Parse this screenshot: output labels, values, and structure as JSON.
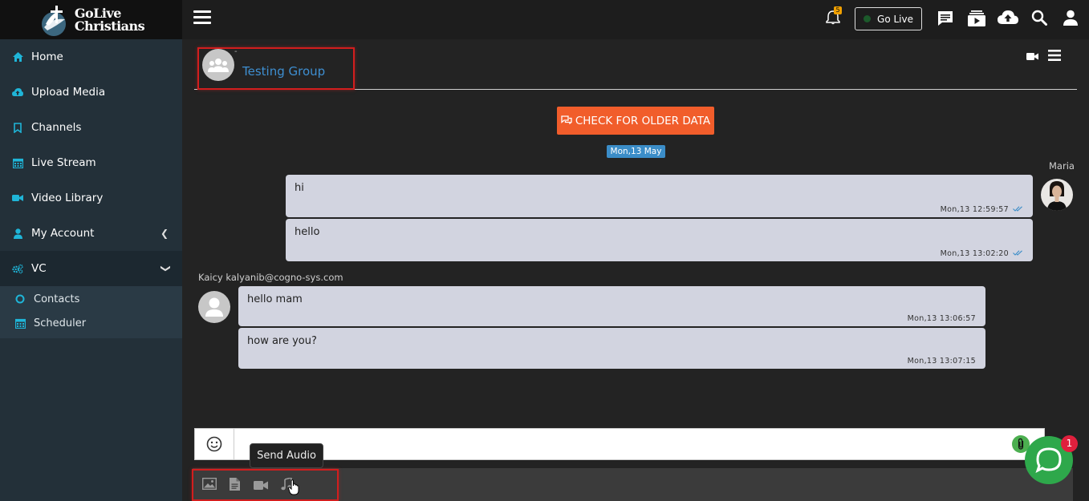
{
  "brand": {
    "line1": "GoLive",
    "line2": "Christians"
  },
  "sidebar": {
    "items": [
      {
        "label": "Home"
      },
      {
        "label": "Upload Media"
      },
      {
        "label": "Channels"
      },
      {
        "label": "Live Stream"
      },
      {
        "label": "Video Library"
      },
      {
        "label": "My Account"
      },
      {
        "label": "VC"
      }
    ],
    "subitems": [
      {
        "label": "Contacts"
      },
      {
        "label": "Scheduler"
      }
    ]
  },
  "topbar": {
    "notification_count": "5",
    "golive_label": "Go Live"
  },
  "chat": {
    "group_dot": "-",
    "group_name": "Testing Group",
    "older_button": "CHECK FOR OLDER DATA",
    "date_chip": "Mon,13 May",
    "outgoing_sender": "Maria",
    "outgoing": [
      {
        "text": "hi",
        "time": "Mon,13 12:59:57"
      },
      {
        "text": "hello",
        "time": "Mon,13 13:02:20"
      }
    ],
    "incoming_sender": "Kaicy  kalyanib@cogno-sys.com",
    "incoming": [
      {
        "text": "hello mam",
        "time": "Mon,13 13:06:57"
      },
      {
        "text": "how are you?",
        "time": "Mon,13 13:07:15"
      }
    ],
    "input_placeholder": ""
  },
  "tooltip": {
    "label": "Send Audio"
  },
  "widget": {
    "badge": "1"
  },
  "colors": {
    "accent": "#3e8fd1",
    "older_button": "#f15d2b",
    "bubble": "#d2d4e0",
    "sidebar": "#233039",
    "widget": "#2ea84b"
  }
}
